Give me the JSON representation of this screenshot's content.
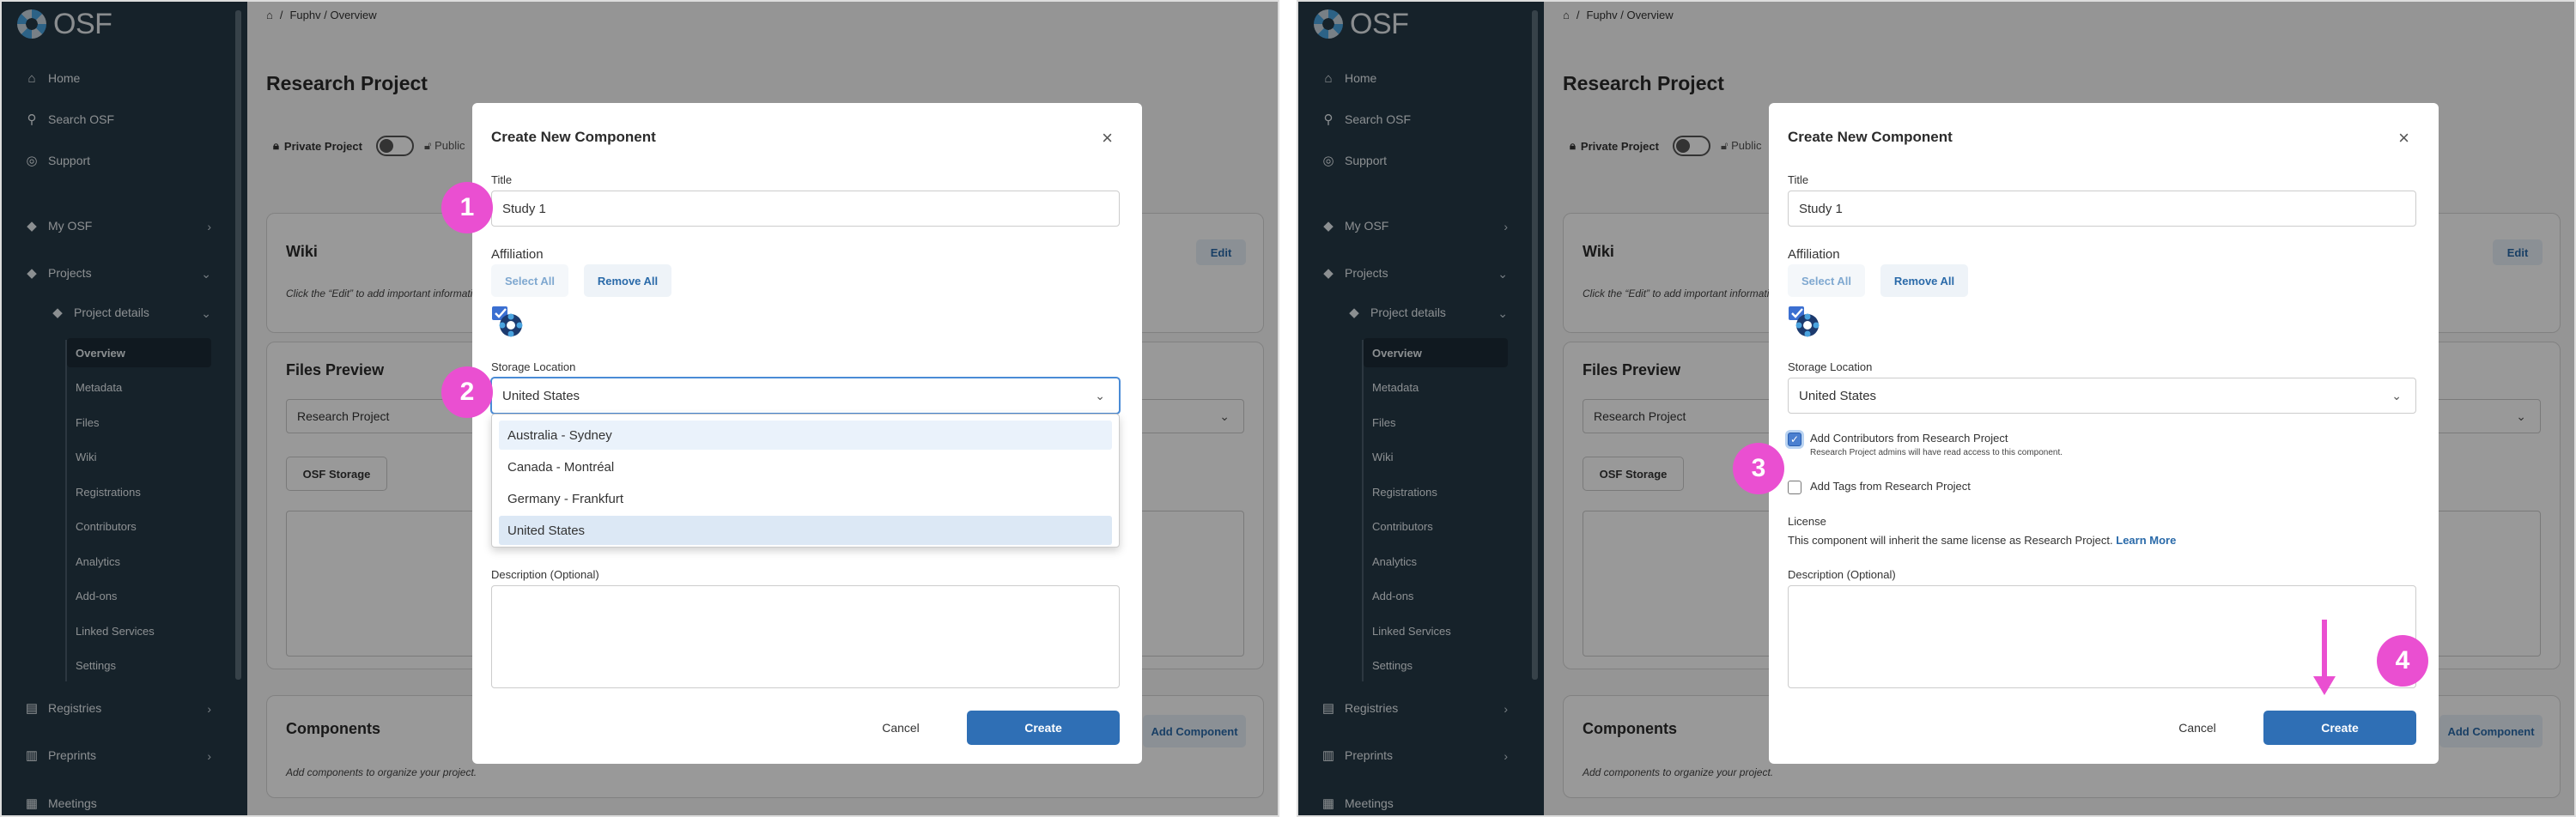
{
  "sidebar": {
    "logo": "OSF",
    "nav": {
      "home": "Home",
      "search": "Search OSF",
      "support": "Support",
      "my_osf": "My OSF",
      "projects": "Projects",
      "project_details": "Project details",
      "registries": "Registries",
      "preprints": "Preprints",
      "meetings": "Meetings"
    },
    "project_sub": [
      "Overview",
      "Metadata",
      "Files",
      "Wiki",
      "Registrations",
      "Contributors",
      "Analytics",
      "Add-ons",
      "Linked Services",
      "Settings"
    ]
  },
  "page": {
    "breadcrumb_sep": "/",
    "breadcrumb": "Fuphv / Overview",
    "title": "Research Project",
    "private_label": "Private Project",
    "public_label": "Public",
    "wiki": {
      "title": "Wiki",
      "edit": "Edit",
      "text": "Click the “Edit” to add important information"
    },
    "files": {
      "title": "Files Preview",
      "select_value": "Research Project",
      "osf_storage": "OSF Storage"
    },
    "components": {
      "title": "Components",
      "add": "Add Component",
      "text": "Add components to organize your project."
    }
  },
  "modal": {
    "title": "Create New Component",
    "close": "×",
    "title_label": "Title",
    "title_value": "Study 1",
    "affiliation_label": "Affiliation",
    "select_all": "Select All",
    "remove_all": "Remove All",
    "storage_label": "Storage Location",
    "storage_value": "United States",
    "storage_options": [
      "Australia - Sydney",
      "Canada - Montréal",
      "Germany - Frankfurt",
      "United States"
    ],
    "add_contributors_label": "Add Contributors from Research Project",
    "add_contributors_sub": "Research Project admins will have read access to this component.",
    "add_tags_label": "Add Tags from Research Project",
    "license_label": "License",
    "license_text": "This component will inherit the same license as Research Project.",
    "learn_more": "Learn More",
    "description_label": "Description (Optional)",
    "cancel": "Cancel",
    "create": "Create"
  },
  "annotations": {
    "step1": "1",
    "step2": "2",
    "step3": "3",
    "step4": "4"
  },
  "colors": {
    "sidebar": "#263947",
    "primary": "#2f6fb5",
    "annotation": "#ea4fd1"
  }
}
